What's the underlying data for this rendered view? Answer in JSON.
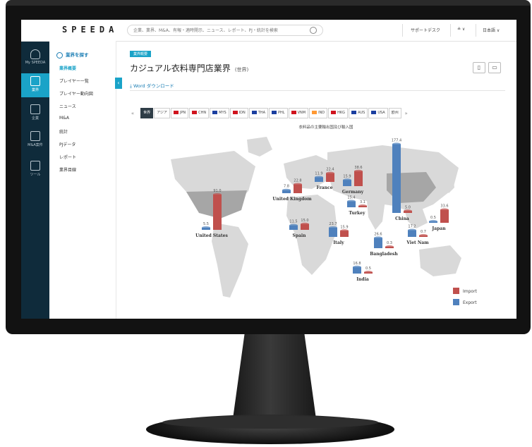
{
  "app": {
    "logo": "SPEEDA",
    "search_placeholder": "企業、業界、M&A、有報・適時開示、ニュース、レポート、PJ・統計を検索",
    "support": "サポートデスク",
    "user_menu": "≗ ∨",
    "language": "日本語 ∨"
  },
  "sidebar": {
    "items": [
      {
        "label": "My SPEEDA",
        "icon": "user-icon"
      },
      {
        "label": "業界",
        "icon": "document-icon"
      },
      {
        "label": "企業",
        "icon": "building-icon"
      },
      {
        "label": "M&A案件",
        "icon": "transaction-icon"
      },
      {
        "label": "ツール",
        "icon": "chart-icon"
      }
    ]
  },
  "submenu": {
    "header": "業界を探す",
    "items": [
      "業界概要",
      "プレイヤー一覧",
      "プレイヤー動向図",
      "ニュース",
      "M&A",
      "統計",
      "PJデータ",
      "レポート",
      "業界目線"
    ],
    "selected": "業界概要"
  },
  "main": {
    "badge": "業界概要",
    "title": "カジュアル衣料専門店業界",
    "scope": "(世界)",
    "word_download": "Word ダウンロード"
  },
  "region_tabs": [
    {
      "label": "世界",
      "flag": null
    },
    {
      "label": "アジア",
      "flag": null
    },
    {
      "label": "JPN",
      "flag": "#d0141e"
    },
    {
      "label": "CHN",
      "flag": "#d0141e"
    },
    {
      "label": "MYS",
      "flag": "#1b3fa0"
    },
    {
      "label": "IDN",
      "flag": "#d0141e"
    },
    {
      "label": "THA",
      "flag": "#1b3fa0"
    },
    {
      "label": "PHL",
      "flag": "#1b3fa0"
    },
    {
      "label": "VNM",
      "flag": "#d0141e"
    },
    {
      "label": "IND",
      "flag": "#ff9933"
    },
    {
      "label": "HKG",
      "flag": "#d0141e"
    },
    {
      "label": "AUS",
      "flag": "#1b3fa0"
    },
    {
      "label": "USA",
      "flag": "#1b3fa0"
    },
    {
      "label": "欧州",
      "flag": null
    }
  ],
  "chart_data": {
    "type": "bar",
    "title": "衣料品の主要輸出国及び輸入国",
    "colors": {
      "Import": "#c0504d",
      "Export": "#4f81bd"
    },
    "categories": [
      "United States",
      "United Kingdom",
      "France",
      "Germany",
      "Turkey",
      "Spain",
      "Italy",
      "China",
      "Bangladesh",
      "Viet Nam",
      "India",
      "Japan"
    ],
    "series": [
      {
        "name": "Import",
        "values": [
          91.0,
          22.8,
          22.4,
          38.6,
          3.1,
          15.0,
          15.9,
          5.0,
          0.3,
          0.7,
          0.5,
          33.6
        ]
      },
      {
        "name": "Export",
        "values": [
          5.5,
          7.8,
          11.9,
          15.9,
          15.4,
          11.5,
          23.7,
          177.4,
          26.6,
          17.2,
          16.8,
          0.5
        ]
      }
    ],
    "legend": [
      "Import",
      "Export"
    ],
    "legend_position": "bottom-right"
  }
}
